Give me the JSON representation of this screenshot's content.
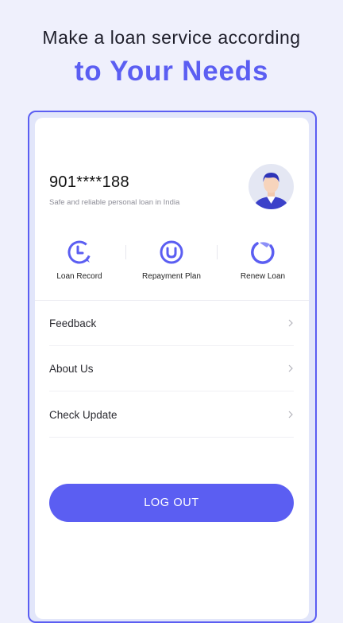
{
  "headline": {
    "line1": "Make a loan service according",
    "line2": "to Your Needs"
  },
  "profile": {
    "phone": "901****188",
    "tagline": "Safe and reliable personal loan in India"
  },
  "quick_actions": [
    {
      "label": "Loan Record",
      "icon": "loan-record-icon"
    },
    {
      "label": "Repayment Plan",
      "icon": "repayment-plan-icon"
    },
    {
      "label": "Renew Loan",
      "icon": "renew-loan-icon"
    }
  ],
  "menu": [
    {
      "label": "Feedback",
      "icon": "chevron-right-icon"
    },
    {
      "label": "About Us",
      "icon": "chevron-right-icon"
    },
    {
      "label": "Check Update",
      "icon": "chevron-right-icon"
    }
  ],
  "logout_label": "LOG OUT",
  "colors": {
    "accent": "#5b5ef2",
    "background": "#eff0fc",
    "card": "#ffffff"
  }
}
